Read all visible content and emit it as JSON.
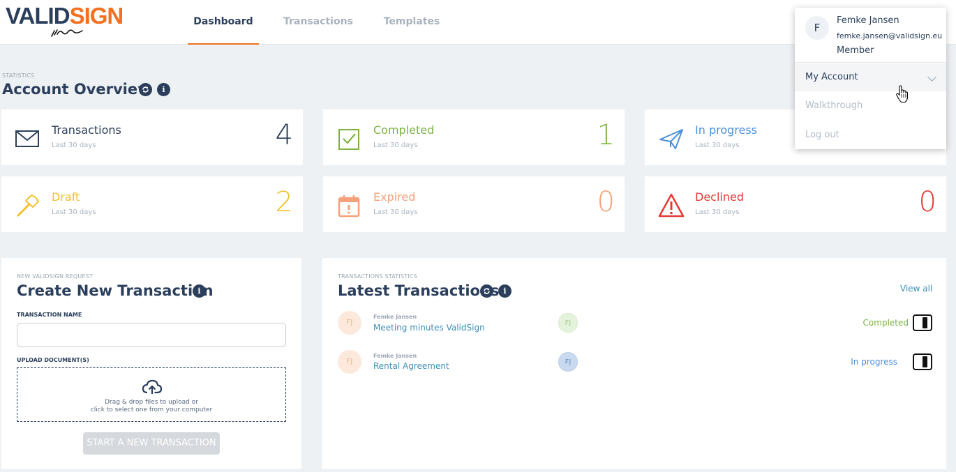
{
  "header": {
    "logo": {
      "part1": "VALID",
      "part2": "SIGN"
    },
    "tabs": [
      {
        "label": "Dashboard",
        "active": true
      },
      {
        "label": "Transactions",
        "active": false
      },
      {
        "label": "Templates",
        "active": false
      }
    ]
  },
  "overview": {
    "eyebrow": "STATISTICS",
    "title": "Account Overview",
    "cards": [
      {
        "label": "Transactions",
        "sub": "Last 30 days",
        "value": "4",
        "color": "#2b3f5c",
        "icon": "envelope-icon"
      },
      {
        "label": "Completed",
        "sub": "Last 30 days",
        "value": "1",
        "color": "#7cb342",
        "icon": "checkbox-icon"
      },
      {
        "label": "In progress",
        "sub": "Last 30 days",
        "value": "",
        "color": "#4a90d9",
        "icon": "paper-plane-icon"
      },
      {
        "label": "Draft",
        "sub": "Last 30 days",
        "value": "2",
        "color": "#f2c12e",
        "icon": "hammer-icon"
      },
      {
        "label": "Expired",
        "sub": "Last 30 days",
        "value": "0",
        "color": "#f5a07a",
        "icon": "calendar-alert-icon"
      },
      {
        "label": "Declined",
        "sub": "Last 30 days",
        "value": "0",
        "color": "#e53935",
        "icon": "warning-icon"
      }
    ]
  },
  "create": {
    "eyebrow": "NEW VALIDSIGN REQUEST",
    "title": "Create New Transaction",
    "name_label": "TRANSACTION NAME",
    "name_value": "",
    "upload_label": "UPLOAD DOCUMENT(S)",
    "dropzone_line1": "Drag & drop files to upload or",
    "dropzone_line2": "click to select one from your computer",
    "start_button": "START A NEW TRANSACTION"
  },
  "latest": {
    "eyebrow": "TRANSACTIONS STATISTICS",
    "title": "Latest Transactions",
    "view_all": "View all",
    "rows": [
      {
        "initials": "FJ",
        "owner": "Femke Jansen",
        "name": "Meeting minutes ValidSign",
        "signer": "FJ",
        "status": "Completed"
      },
      {
        "initials": "FJ",
        "owner": "Femke Jansen",
        "name": "Rental Agreement",
        "signer": "FJ",
        "status": "In progress"
      }
    ]
  },
  "user_menu": {
    "initial": "F",
    "name": "Femke Jansen",
    "email": "femke.jansen@validsign.eu",
    "role": "Member",
    "items": [
      "My Account",
      "Walkthrough",
      "Log out"
    ]
  }
}
